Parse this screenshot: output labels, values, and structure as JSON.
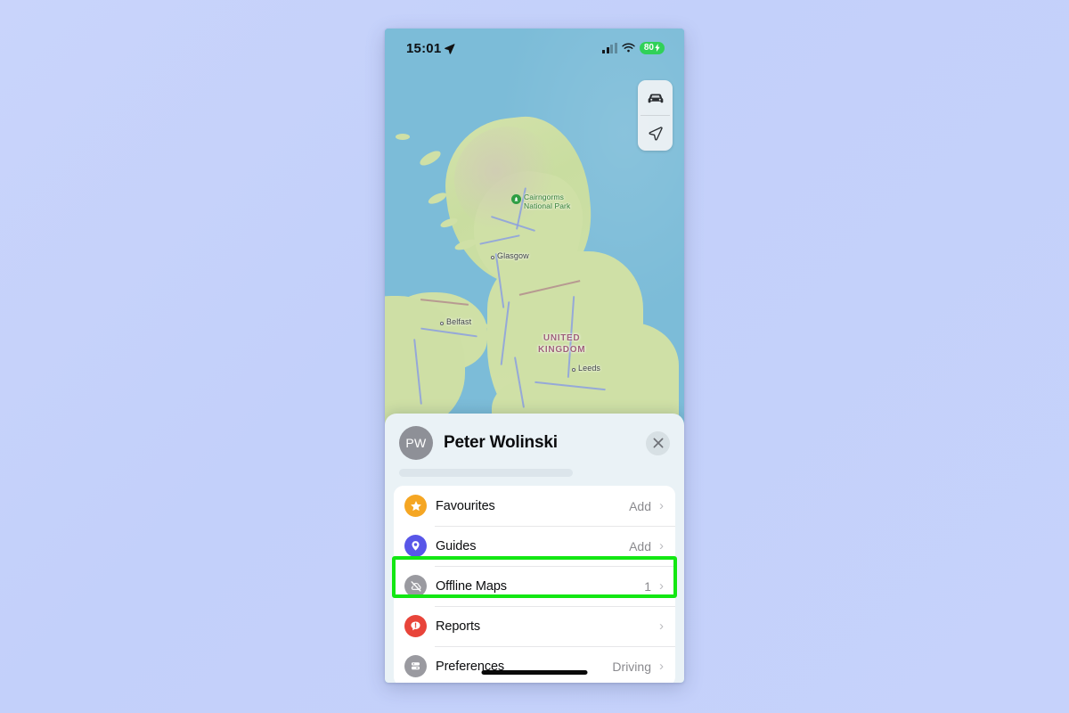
{
  "status_bar": {
    "time": "15:01",
    "location_arrow": "location-arrow-icon",
    "cellular": "signal-bars-icon",
    "wifi": "wifi-icon",
    "battery_percent": "80",
    "battery_charging": true
  },
  "map": {
    "controls": [
      {
        "name": "driving-mode-button",
        "icon": "car-icon"
      },
      {
        "name": "locate-me-button",
        "icon": "navigation-arrow-icon"
      }
    ],
    "labels": [
      {
        "text": "Cairngorms\nNational Park",
        "type": "park",
        "line1": "Cairngorms",
        "line2": "National Park"
      },
      {
        "text": "Glasgow",
        "type": "city"
      },
      {
        "text": "Belfast",
        "type": "city"
      },
      {
        "text": "Leeds",
        "type": "city"
      },
      {
        "text": "UNITED KINGDOM",
        "type": "country",
        "line1": "UNITED",
        "line2": "KINGDOM"
      }
    ]
  },
  "sheet": {
    "user": {
      "initials": "PW",
      "name": "Peter Wolinski"
    },
    "close_label": "×",
    "items": [
      {
        "label": "Favourites",
        "value": "Add",
        "icon": "star-icon",
        "icon_color": "#f5a623",
        "name": "favourites"
      },
      {
        "label": "Guides",
        "value": "Add",
        "icon": "guides-pin-icon",
        "icon_color": "#5856e8",
        "name": "guides"
      },
      {
        "label": "Offline Maps",
        "value": "1",
        "icon": "offline-maps-icon",
        "icon_color": "#8e8e93",
        "name": "offline-maps"
      },
      {
        "label": "Reports",
        "value": "",
        "icon": "report-bubble-icon",
        "icon_color": "#e8443a",
        "name": "reports"
      },
      {
        "label": "Preferences",
        "value": "Driving",
        "icon": "car-front-icon",
        "icon_color": "#8e8e93",
        "name": "preferences"
      }
    ],
    "chevron": "›"
  },
  "annotation": {
    "highlight_color": "#13e713",
    "highlight_target": "Offline Maps"
  }
}
